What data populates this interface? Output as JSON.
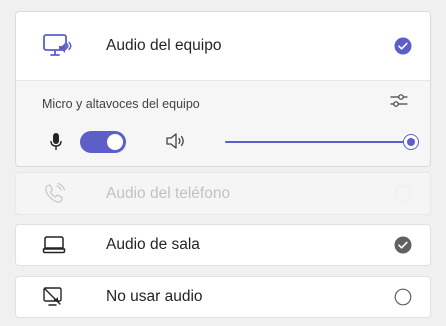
{
  "options": {
    "computer_audio": {
      "label": "Audio del equipo",
      "selected": true,
      "icon": "monitor-speaker-icon"
    },
    "computer_settings": {
      "label": "Micro y altavoces del equipo",
      "mic_enabled": true,
      "speaker_volume": 1.0
    },
    "phone_audio": {
      "label": "Audio del teléfono",
      "disabled": true,
      "icon": "phone-sound-icon"
    },
    "room_audio": {
      "label": "Audio de sala",
      "selected": false,
      "icon": "room-device-icon"
    },
    "no_audio": {
      "label": "No usar audio",
      "selected": false,
      "icon": "monitor-muted-icon"
    }
  },
  "colors": {
    "accent": "#5b5fc7",
    "text": "#242424",
    "muted_text": "#424242",
    "disabled_text": "#c2c2c2",
    "check_gray": "#616161",
    "background": "#f0f0f0"
  }
}
